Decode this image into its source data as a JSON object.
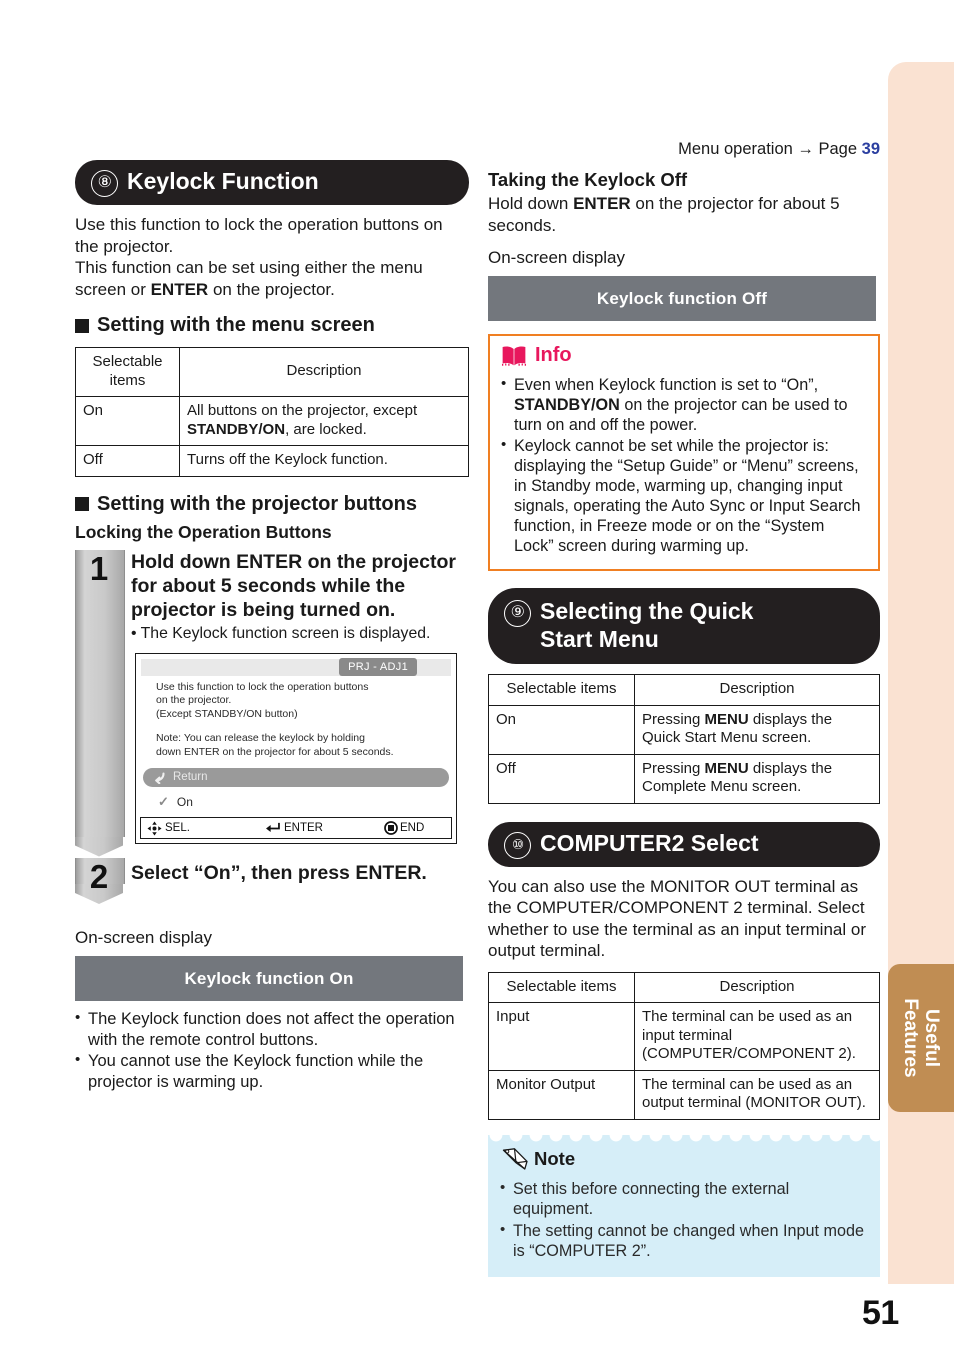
{
  "page": {
    "number": "51",
    "side_tab": "Useful\nFeatures",
    "menu_reference": {
      "text": "Menu operation",
      "arrow": "→",
      "page_label": "Page",
      "page_number": "39"
    },
    "accent_colors": {
      "side_tab_bg": "#c08d53",
      "edge_strip_bg": "#fae2d2",
      "info_border": "#f07f22",
      "info_title": "#e8175d",
      "note_bg": "#d6eef8",
      "link_blue": "#2b3fa0",
      "osd_banner_bg": "#73777d",
      "section_header_bg": "#231f20"
    }
  },
  "section_keylock": {
    "number": "⑧",
    "title": "Keylock Function",
    "intro_1": "Use this function to lock the operation buttons on the projector.",
    "intro_2_a": "This function can be set using either the menu screen or ",
    "intro_2_b": "ENTER",
    "intro_2_c": " on the projector.",
    "subhead_menu": "Setting with the menu screen",
    "table": {
      "headers": [
        "Selectable items",
        "Description"
      ],
      "rows": [
        {
          "item": "On",
          "desc_a": "All buttons on the projector, except ",
          "desc_b": "STANDBY/ON",
          "desc_c": ", are locked."
        },
        {
          "item": "Off",
          "desc_a": "Turns off the Keylock function.",
          "desc_b": "",
          "desc_c": ""
        }
      ]
    },
    "subhead_buttons": "Setting with the projector buttons",
    "subhead_locking": "Locking the Operation Buttons",
    "step1": {
      "number": "1",
      "text_a": "Hold down ",
      "text_b": "ENTER",
      "text_c": " on the projector for about 5 seconds while the projector is being turned on.",
      "bullet": "The Keylock function screen is displayed."
    },
    "osd_mockup": {
      "tab_label": "PRJ - ADJ1",
      "line_1": "Use this function to lock the operation buttons",
      "line_2": "on the projector.",
      "line_3": "(Except STANDBY/ON button)",
      "line_4": "Note: You can release the keylock by holding",
      "line_5": "down ENTER on the projector for about 5 seconds.",
      "return_label": "Return",
      "return_icon": "return-arrow-icon",
      "option_label": "On",
      "option_icon": "checkmark-icon",
      "footer": {
        "sel_icon": "four-way-arrow-icon",
        "sel_label": "SEL.",
        "enter_icon": "enter-key-icon",
        "enter_label": "ENTER",
        "end_icon": "end-button-icon",
        "end_label": "END"
      }
    },
    "step2": {
      "number": "2",
      "text_a": "Select “On”, then press ",
      "text_b": "ENTER."
    },
    "onscreen_label": "On-screen display",
    "banner_on": "Keylock function On",
    "bullets_after": [
      "The Keylock function does not affect the operation with the remote control buttons.",
      "You cannot use the Keylock function while the projector is warming up."
    ]
  },
  "section_keylock_off": {
    "heading": "Taking the Keylock Off",
    "text_a": "Hold down ",
    "text_b": "ENTER",
    "text_c": " on the projector for about 5 seconds.",
    "onscreen_label": "On-screen display",
    "banner_off": "Keylock function Off"
  },
  "info_box": {
    "icon": "open-book-icon",
    "title": "Info",
    "bullets": [
      {
        "a": "Even when Keylock function is set to “On”, ",
        "b": "STANDBY/ON",
        "c": " on the projector can be used to turn on and off the power."
      },
      {
        "a": "Keylock cannot be set while the projector is: displaying the “Setup Guide” or “Menu” screens, in Standby mode, warming up, changing input signals, operating the Auto Sync or Input Search function, in Freeze mode or on the “System Lock” screen during warming up.",
        "b": "",
        "c": ""
      }
    ]
  },
  "section_quickstart": {
    "number": "⑨",
    "title": "Selecting the Quick\nStart Menu",
    "table": {
      "headers": [
        "Selectable items",
        "Description"
      ],
      "rows": [
        {
          "item": "On",
          "desc_a": "Pressing ",
          "desc_b": "MENU",
          "desc_c": " displays the Quick Start Menu screen."
        },
        {
          "item": "Off",
          "desc_a": "Pressing ",
          "desc_b": "MENU",
          "desc_c": " displays the Complete Menu screen."
        }
      ]
    }
  },
  "section_computer2": {
    "number": "⑩",
    "title": "COMPUTER2 Select",
    "intro": "You can also use the MONITOR OUT terminal as the COMPUTER/COMPONENT 2 terminal. Select whether to use the terminal as an input terminal or output terminal.",
    "table": {
      "headers": [
        "Selectable items",
        "Description"
      ],
      "rows": [
        {
          "item": "Input",
          "desc_a": "The terminal can be used as an input terminal (COMPUTER/COMPONENT 2).",
          "desc_b": "",
          "desc_c": ""
        },
        {
          "item": "Monitor Output",
          "desc_a": "The terminal can be used as an output terminal (MONITOR OUT).",
          "desc_b": "",
          "desc_c": ""
        }
      ]
    }
  },
  "note_box": {
    "icon": "pencil-icon",
    "title": "Note",
    "bullets": [
      "Set this before connecting the external equipment.",
      "The setting cannot be changed when Input mode is “COMPUTER 2”."
    ]
  }
}
